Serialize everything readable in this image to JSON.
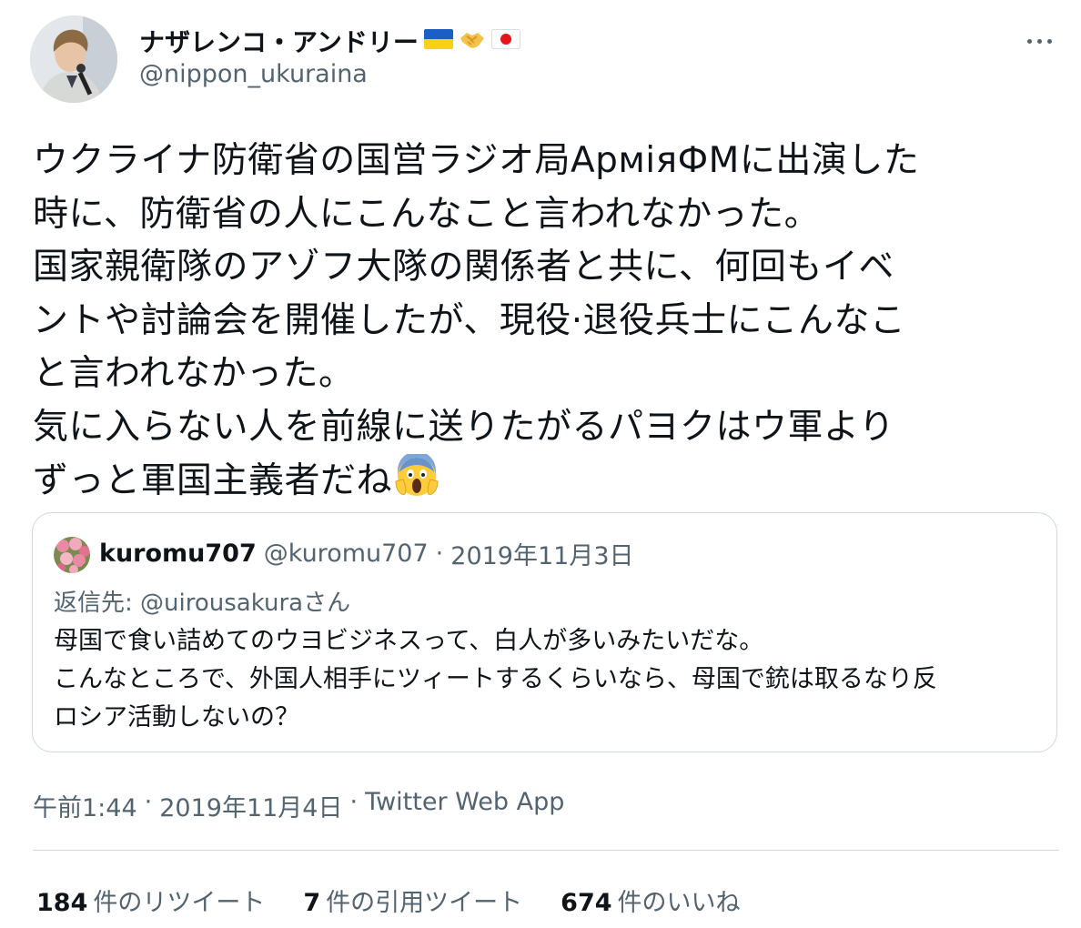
{
  "author": {
    "display_name": "ナザレンコ・アンドリー",
    "handle": "@nippon_ukuraina",
    "emojis": [
      "flag-ukraine-icon",
      "handshake-icon",
      "flag-japan-icon"
    ]
  },
  "tweet": {
    "lines": [
      "ウクライナ防衛省の国営ラジオ局АрміяФМに出演した",
      "時に、防衛省の人にこんなこと言われなかった。",
      "国家親衛隊のアゾフ大隊の関係者と共に、何回もイベ",
      "ントや討論会を開催したが、現役·退役兵士にこんなこ",
      "と言われなかった。",
      "気に入らない人を前線に送りたがるパヨクはウ軍より",
      "ずっと軍国主義者だね"
    ],
    "trailing_emoji": "face-screaming-in-fear-icon"
  },
  "quote": {
    "name": "kuromu707",
    "handle": "@kuromu707",
    "separator": "·",
    "date": "2019年11月3日",
    "reply_prefix": "返信先: ",
    "reply_to": "@uirousakura",
    "reply_suffix": "さん",
    "lines": [
      "母国で食い詰めてのウヨビジネスって、白人が多いみたいだな。",
      "こんなところで、外国人相手にツィートするくらいなら、母国で銃は取るなり反",
      "ロシア活動しないの？"
    ]
  },
  "meta": {
    "time": "午前1:44",
    "sep1": "·",
    "date": "2019年11月4日",
    "sep2": "·",
    "app": "Twitter Web App"
  },
  "stats": {
    "retweets_count": "184",
    "retweets_label": "件のリツイート",
    "quotes_count": "7",
    "quotes_label": "件の引用ツイート",
    "likes_count": "674",
    "likes_label": "件のいいね"
  },
  "colors": {
    "text_primary": "#0f1419",
    "text_secondary": "#536471",
    "border": "#cfd9de"
  }
}
